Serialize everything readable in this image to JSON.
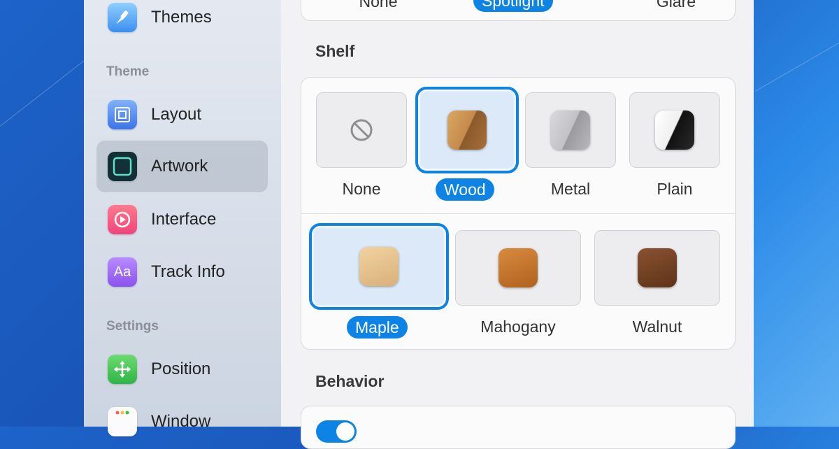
{
  "sidebar": {
    "items": [
      {
        "label": "Themes",
        "icon": "brush-icon"
      },
      {
        "label": "Layout",
        "icon": "layout-icon"
      },
      {
        "label": "Artwork",
        "icon": "artwork-icon"
      },
      {
        "label": "Interface",
        "icon": "play-circle-icon"
      },
      {
        "label": "Track Info",
        "icon": "text-aa-icon"
      },
      {
        "label": "Position",
        "icon": "move-arrows-icon"
      },
      {
        "label": "Window",
        "icon": "window-icon"
      }
    ],
    "headers": {
      "theme": "Theme",
      "settings": "Settings"
    },
    "selected": "Artwork"
  },
  "main": {
    "top_options": [
      "None",
      "Spotlight",
      "Glare"
    ],
    "top_selected": "Spotlight",
    "shelf": {
      "title": "Shelf",
      "styles": [
        "None",
        "Wood",
        "Metal",
        "Plain"
      ],
      "selected_style": "Wood",
      "woods": [
        "Maple",
        "Mahogany",
        "Walnut"
      ],
      "selected_wood": "Maple"
    },
    "behavior": {
      "title": "Behavior"
    }
  },
  "colors": {
    "accent": "#0d84e5"
  }
}
